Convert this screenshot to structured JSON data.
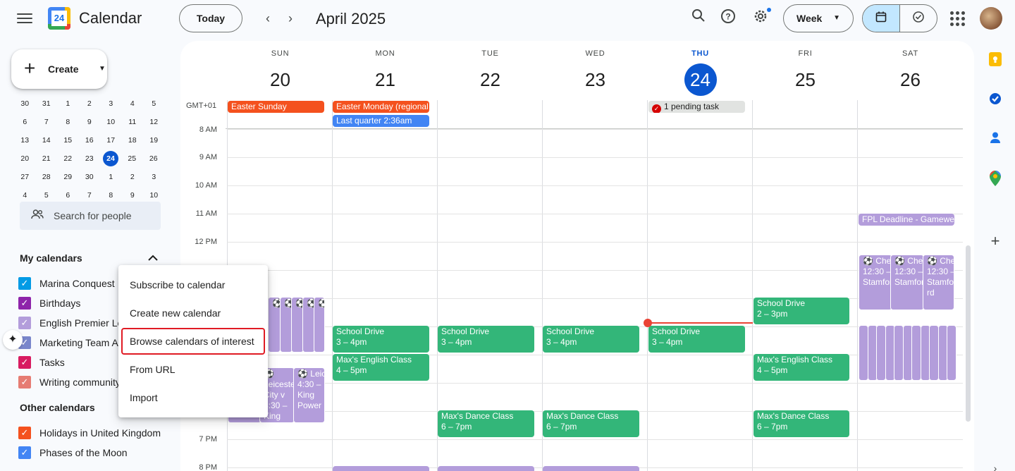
{
  "header": {
    "app_title": "Calendar",
    "logo_day": "24",
    "today_label": "Today",
    "month_title": "April 2025",
    "view_label": "Week"
  },
  "sidebar": {
    "create_label": "Create",
    "mini_calendar": [
      [
        "30",
        "31",
        "1",
        "2",
        "3",
        "4",
        "5"
      ],
      [
        "6",
        "7",
        "8",
        "9",
        "10",
        "11",
        "12"
      ],
      [
        "13",
        "14",
        "15",
        "16",
        "17",
        "18",
        "19"
      ],
      [
        "20",
        "21",
        "22",
        "23",
        "24",
        "25",
        "26"
      ],
      [
        "27",
        "28",
        "29",
        "30",
        "1",
        "2",
        "3"
      ],
      [
        "4",
        "5",
        "6",
        "7",
        "8",
        "9",
        "10"
      ]
    ],
    "search_placeholder": "Search for people",
    "my_calendars_title": "My calendars",
    "my_calendars": [
      {
        "name": "Marina Conquest",
        "color": "#039be5"
      },
      {
        "name": "Birthdays",
        "color": "#8e24aa"
      },
      {
        "name": "English Premier League",
        "color": "#b39ddb"
      },
      {
        "name": "Marketing Team Activities",
        "color": "#7986cb"
      },
      {
        "name": "Tasks",
        "color": "#d81b60"
      },
      {
        "name": "Writing community",
        "color": "#e67c73"
      }
    ],
    "other_calendars_title": "Other calendars",
    "other_calendars": [
      {
        "name": "Holidays in United Kingdom",
        "color": "#f4511e"
      },
      {
        "name": "Phases of the Moon",
        "color": "#4285f4"
      }
    ]
  },
  "week": {
    "timezone": "GMT+01",
    "days": [
      {
        "name": "SUN",
        "date": "20"
      },
      {
        "name": "MON",
        "date": "21"
      },
      {
        "name": "TUE",
        "date": "22"
      },
      {
        "name": "WED",
        "date": "23"
      },
      {
        "name": "THU",
        "date": "24"
      },
      {
        "name": "FRI",
        "date": "25"
      },
      {
        "name": "SAT",
        "date": "26"
      }
    ],
    "hours": [
      "8 AM",
      "9 AM",
      "10 AM",
      "11 AM",
      "12 PM",
      "7 PM",
      "8 PM"
    ],
    "allday": {
      "easter_sunday": "Easter Sunday",
      "easter_monday": "Easter Monday (regional holiday)",
      "last_quarter": "Last quarter 2:36am",
      "pending_task": "1 pending task"
    },
    "events": {
      "school_drive": "School Drive",
      "school_drive_time": "3 – 4pm",
      "school_drive_fri_time": "2 – 3pm",
      "english_class": "Max's English Class",
      "english_class_time": "4 – 5pm",
      "dance_class": "Max's Dance Class",
      "dance_class_time": "6 – 7pm",
      "fpl_deadline": "FPL Deadline - Gameweek",
      "chelsea_1": "⚽ Chelsea v Everton",
      "chelsea_1_time": "12:30 –",
      "chelsea_1_place": "Stamford Bridge",
      "chelsea_3_title": "⚽ Chelsea",
      "chelsea_3_time": "12:30 –",
      "chelsea_3_place": "Stamford",
      "chelsea_3_place2": "rd",
      "leicester_1": "⚽ Leicester City v",
      "leicester_1_time": "4:30 –",
      "leicester_1_place": "King Power Stadium",
      "leicester_2": "⚽ Leicester",
      "leicester_2_time": "4:30 –",
      "leicester_2_place": "King",
      "leicester_2_place2": "Power"
    }
  },
  "context_menu": {
    "items": [
      "Subscribe to calendar",
      "Create new calendar",
      "Browse calendars of interest",
      "From URL",
      "Import"
    ]
  }
}
